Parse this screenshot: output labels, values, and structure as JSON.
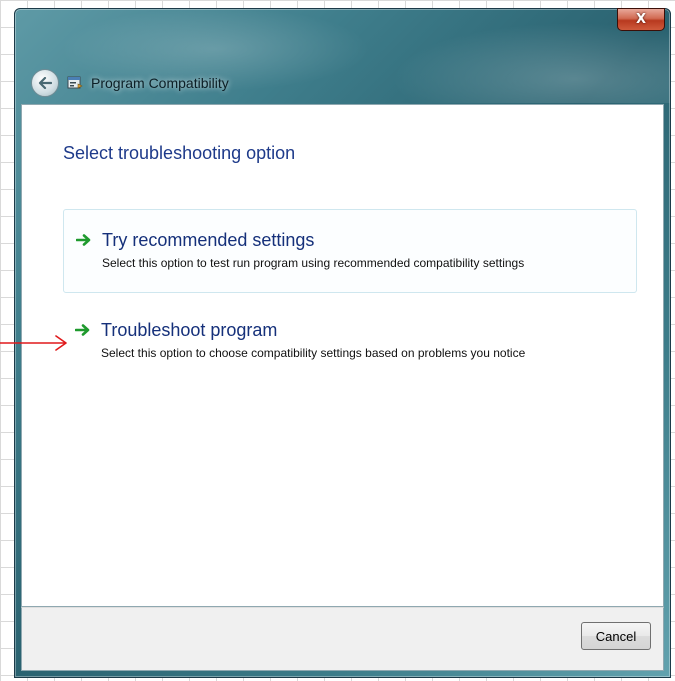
{
  "window": {
    "title": "Program Compatibility",
    "close_label": "X"
  },
  "main": {
    "heading": "Select troubleshooting option",
    "options": [
      {
        "title": "Try recommended settings",
        "description": "Select this option to test run program using recommended compatibility settings"
      },
      {
        "title": "Troubleshoot program",
        "description": "Select this option to choose compatibility settings based on problems you notice"
      }
    ]
  },
  "footer": {
    "cancel_label": "Cancel"
  },
  "icons": {
    "back": "back-arrow-icon",
    "app": "program-compatibility-icon",
    "option_arrow": "green-arrow-icon",
    "annotation": "red-pointer-arrow"
  },
  "colors": {
    "heading": "#1e3a8a",
    "option_arrow": "#1f9a2e",
    "close_button": "#c0462a",
    "annotation_arrow": "#e0191b"
  }
}
